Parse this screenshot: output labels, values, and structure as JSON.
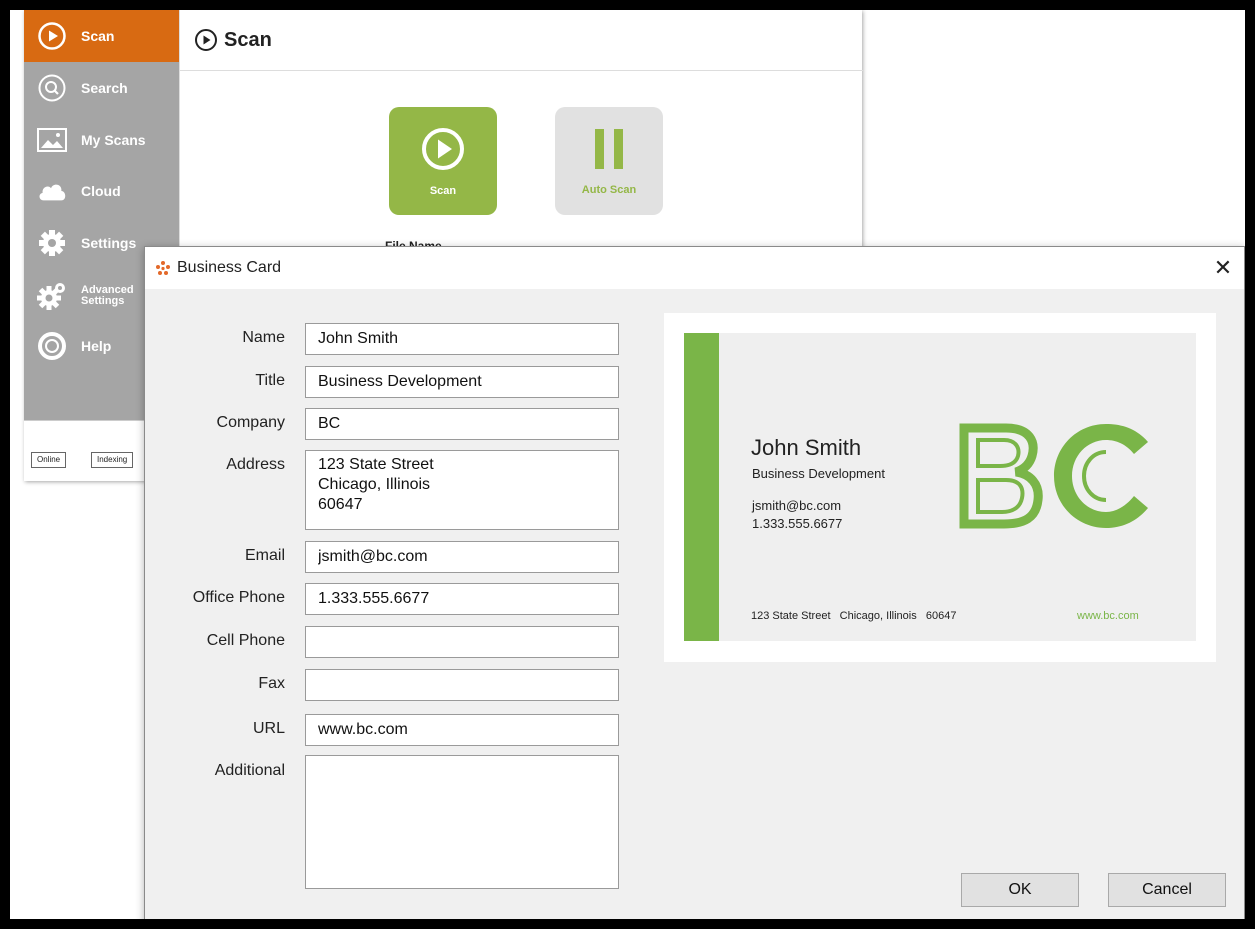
{
  "app": {
    "sidebar": {
      "items": [
        {
          "label": "Scan",
          "icon": "play-circle-icon",
          "active": true
        },
        {
          "label": "Search",
          "icon": "search-icon"
        },
        {
          "label": "My Scans",
          "icon": "image-icon"
        },
        {
          "label": "Cloud",
          "icon": "cloud-icon"
        },
        {
          "label": "Settings",
          "icon": "gear-icon"
        },
        {
          "label": "Advanced Settings",
          "icon": "advanced-gear-icon"
        },
        {
          "label": "Help",
          "icon": "lifebuoy-icon"
        }
      ]
    },
    "status": {
      "online": "Online",
      "indexing": "Indexing"
    },
    "main": {
      "title": "Scan",
      "scan_button": "Scan",
      "auto_scan_button": "Auto Scan",
      "file_name_label": "File Name"
    }
  },
  "colors": {
    "accent_orange": "#d86a12",
    "sidebar_gray": "#a5a5a5",
    "scan_green": "#94b747",
    "card_green": "#7ab548"
  },
  "dialog": {
    "title": "Business Card",
    "close_label": "✕",
    "fields": {
      "name": {
        "label": "Name",
        "value": "John Smith"
      },
      "title": {
        "label": "Title",
        "value": "Business Development"
      },
      "company": {
        "label": "Company",
        "value": "BC"
      },
      "address": {
        "label": "Address",
        "value": "123 State Street\nChicago, Illinois\n60647"
      },
      "email": {
        "label": "Email",
        "value": "jsmith@bc.com"
      },
      "office_phone": {
        "label": "Office Phone",
        "value": "1.333.555.6677"
      },
      "cell_phone": {
        "label": "Cell Phone",
        "value": ""
      },
      "fax": {
        "label": "Fax",
        "value": ""
      },
      "url": {
        "label": "URL",
        "value": "www.bc.com"
      },
      "additional": {
        "label": "Additional",
        "value": ""
      }
    },
    "card": {
      "name": "John Smith",
      "title": "Business Development",
      "email": "jsmith@bc.com",
      "phone": "1.333.555.6677",
      "address": "123 State Street   Chicago, Illinois   60647",
      "url": "www.bc.com",
      "logo": "BC"
    },
    "ok_label": "OK",
    "cancel_label": "Cancel"
  }
}
